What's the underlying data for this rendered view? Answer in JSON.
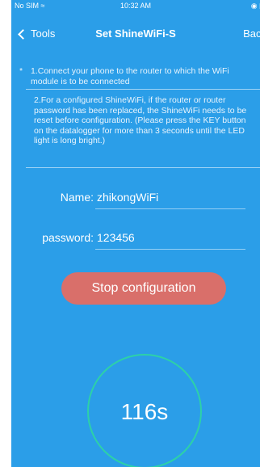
{
  "status_bar": {
    "carrier": "No SIM ≈",
    "time": "10:32 AM",
    "battery": "◉ ▮"
  },
  "nav": {
    "back_label": "Tools",
    "title": "Set ShineWiFi-S",
    "right_label": "Back"
  },
  "tips": {
    "star": "*",
    "tip1": "1.Connect your phone to the router to which the WiFi module is to be connected",
    "tip2": "2.For a configured ShineWiFi, if the router or router password has been replaced, the ShineWiFi needs to be reset before configuration. (Please press the KEY button on the datalogger for more than 3 seconds until the LED light is long bright.)"
  },
  "form": {
    "name_label": "Name:",
    "name_value": "zhikongWiFi",
    "password_label": "password:",
    "password_value": "123456"
  },
  "action": {
    "stop_label": "Stop configuration"
  },
  "timer": {
    "countdown": "116s",
    "ring_color": "#2dd1a8"
  },
  "colors": {
    "background": "#2b9ee8",
    "button": "#d96f6a"
  }
}
